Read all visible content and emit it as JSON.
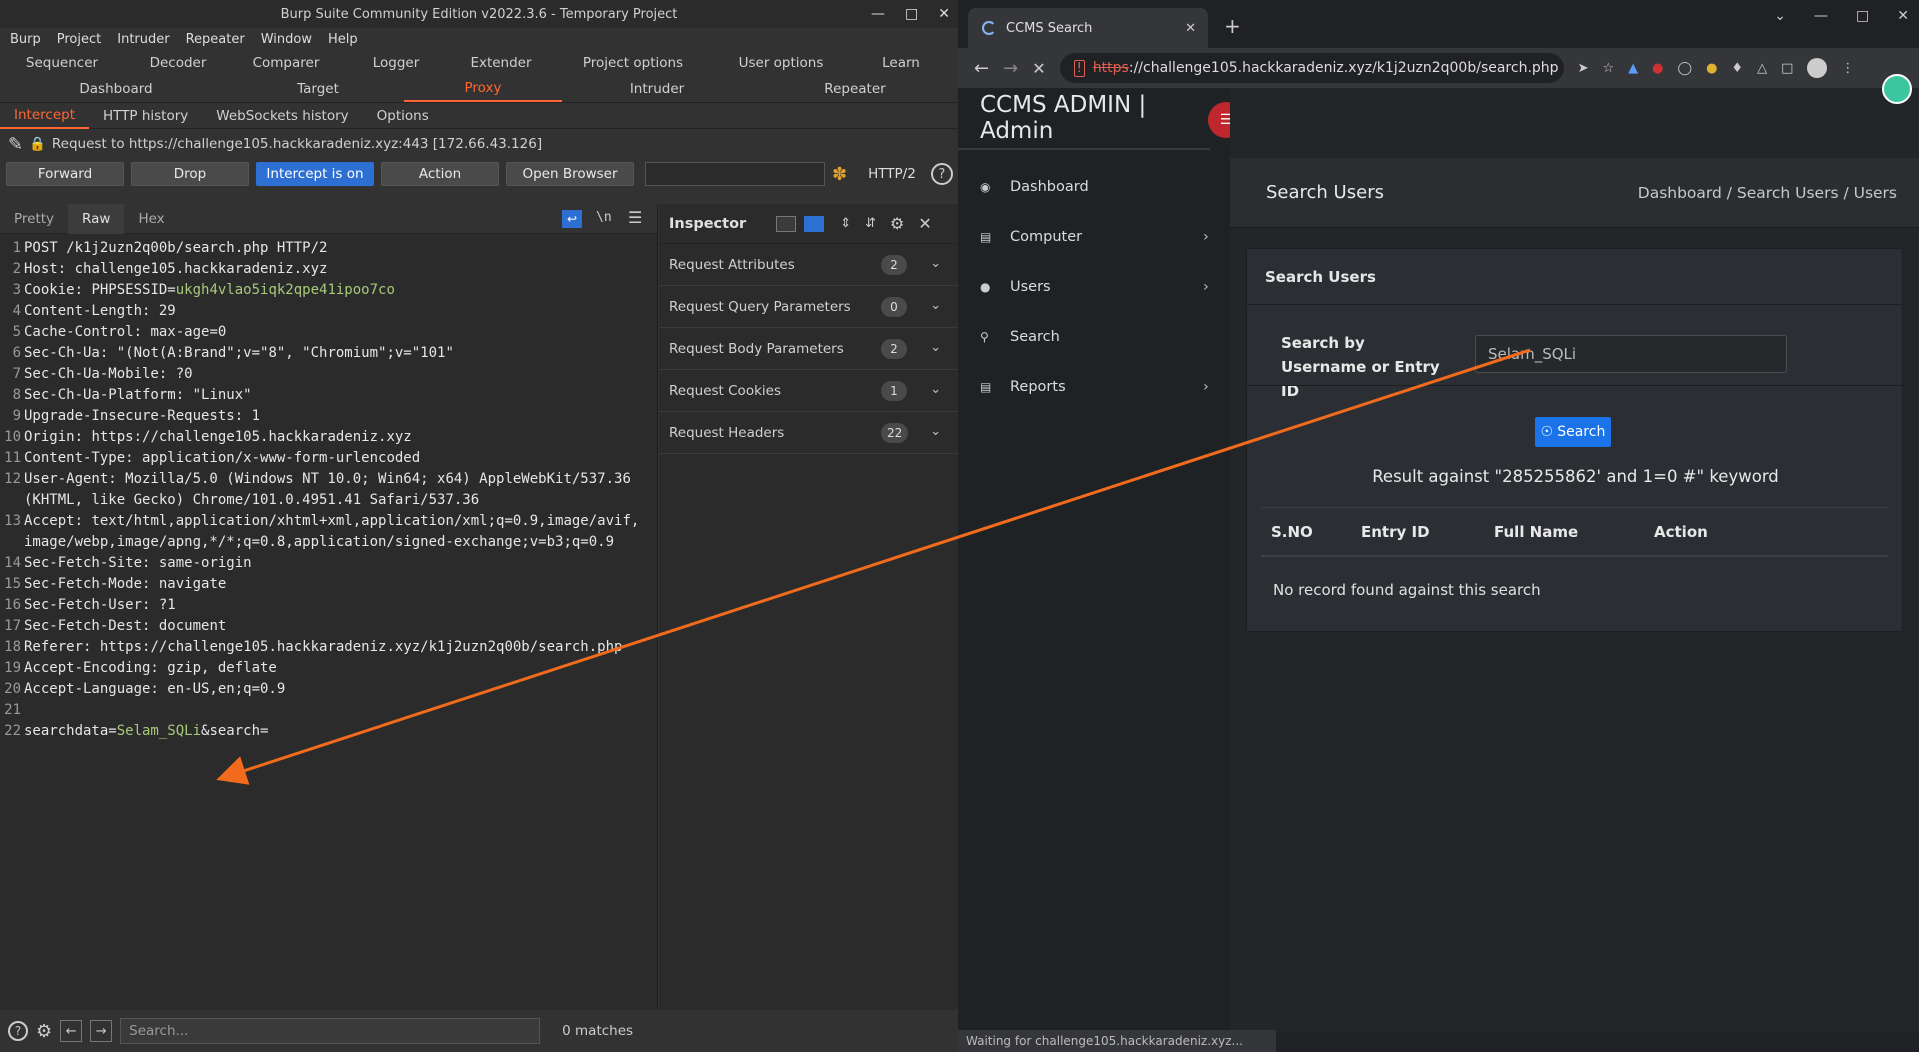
{
  "burp": {
    "title": "Burp Suite Community Edition v2022.3.6 - Temporary Project",
    "menu": [
      "Burp",
      "Project",
      "Intruder",
      "Repeater",
      "Window",
      "Help"
    ],
    "tabs_row1": [
      "Sequencer",
      "Decoder",
      "Comparer",
      "Logger",
      "Extender",
      "Project options",
      "User options",
      "Learn"
    ],
    "tabs_row2": [
      "Dashboard",
      "Target",
      "Proxy",
      "Intruder",
      "Repeater"
    ],
    "subtabs": [
      "Intercept",
      "HTTP history",
      "WebSockets history",
      "Options"
    ],
    "request_to": "Request to https://challenge105.hackkaradeniz.xyz:443  [172.66.43.126]",
    "buttons": {
      "forward": "Forward",
      "drop": "Drop",
      "intercept": "Intercept is on",
      "action": "Action",
      "open_browser": "Open Browser",
      "http2": "HTTP/2"
    },
    "editor_tabs": [
      "Pretty",
      "Raw",
      "Hex"
    ],
    "newline_label": "\\n",
    "lines": [
      {
        "n": "1",
        "k": "POST /k1j2uzn2q00b/search.php HTTP/2",
        "v": ""
      },
      {
        "n": "2",
        "k": "Host:",
        "v": " challenge105.hackkaradeniz.xyz"
      },
      {
        "n": "3",
        "k": "Cookie:",
        "v": " PHPSESSID=",
        "g": "ukgh4vlao5iqk2qpe41ipoo7co"
      },
      {
        "n": "4",
        "k": "Content-Length:",
        "v": " 29"
      },
      {
        "n": "5",
        "k": "Cache-Control:",
        "v": " max-age=0"
      },
      {
        "n": "6",
        "k": "Sec-Ch-Ua:",
        "v": " \"(Not(A:Brand\";v=\"8\", \"Chromium\";v=\"101\""
      },
      {
        "n": "7",
        "k": "Sec-Ch-Ua-Mobile:",
        "v": " ?0"
      },
      {
        "n": "8",
        "k": "Sec-Ch-Ua-Platform:",
        "v": " \"Linux\""
      },
      {
        "n": "9",
        "k": "Upgrade-Insecure-Requests:",
        "v": " 1"
      },
      {
        "n": "10",
        "k": "Origin:",
        "v": " https://challenge105.hackkaradeniz.xyz"
      },
      {
        "n": "11",
        "k": "Content-Type:",
        "v": " application/x-www-form-urlencoded"
      },
      {
        "n": "12",
        "k": "User-Agent:",
        "v": " Mozilla/5.0 (Windows NT 10.0; Win64; x64) AppleWebKit/537.36 (KHTML, like Gecko) Chrome/101.0.4951.41 Safari/537.36"
      },
      {
        "n": "13",
        "k": "Accept:",
        "v": " text/html,application/xhtml+xml,application/xml;q=0.9,image/avif,image/webp,image/apng,*/*;q=0.8,application/signed-exchange;v=b3;q=0.9"
      },
      {
        "n": "14",
        "k": "Sec-Fetch-Site:",
        "v": " same-origin"
      },
      {
        "n": "15",
        "k": "Sec-Fetch-Mode:",
        "v": " navigate"
      },
      {
        "n": "16",
        "k": "Sec-Fetch-User:",
        "v": " ?1"
      },
      {
        "n": "17",
        "k": "Sec-Fetch-Dest:",
        "v": " document"
      },
      {
        "n": "18",
        "k": "Referer:",
        "v": " https://challenge105.hackkaradeniz.xyz/k1j2uzn2q00b/search.php"
      },
      {
        "n": "19",
        "k": "Accept-Encoding:",
        "v": " gzip, deflate"
      },
      {
        "n": "20",
        "k": "Accept-Language:",
        "v": " en-US,en;q=0.9"
      },
      {
        "n": "21",
        "k": "",
        "v": ""
      },
      {
        "n": "22",
        "k": "searchdata=",
        "g": "Selam_SQLi",
        "v2": "&search="
      }
    ],
    "inspector": {
      "title": "Inspector",
      "rows": [
        {
          "label": "Request Attributes",
          "count": "2"
        },
        {
          "label": "Request Query Parameters",
          "count": "0"
        },
        {
          "label": "Request Body Parameters",
          "count": "2"
        },
        {
          "label": "Request Cookies",
          "count": "1"
        },
        {
          "label": "Request Headers",
          "count": "22"
        }
      ]
    },
    "search_placeholder": "Search...",
    "matches": "0 matches"
  },
  "browser": {
    "tab_title": "CCMS Search",
    "url_scheme": "https",
    "url_rest": "://challenge105.hackkaradeniz.xyz/k1j2uzn2q00b/search.php",
    "status": "Waiting for challenge105.hackkaradeniz.xyz...",
    "page": {
      "brand": "CCMS ADMIN | Admin",
      "nav": [
        {
          "label": "Dashboard",
          "icon": "dashboard-icon",
          "arrow": false
        },
        {
          "label": "Computer",
          "icon": "computer-icon",
          "arrow": true
        },
        {
          "label": "Users",
          "icon": "user-icon",
          "arrow": true
        },
        {
          "label": "Search",
          "icon": "search-icon",
          "arrow": false
        },
        {
          "label": "Reports",
          "icon": "report-icon",
          "arrow": true
        }
      ],
      "header_title": "Search Users",
      "breadcrumb": "Dashboard /  Search Users /  Users",
      "card_title": "Search Users",
      "field_label": "Search by Username or Entry ID",
      "field_value": "Selam_SQLi",
      "search_button": "Search",
      "result_text": "Result against \"285255862' and 1=0 #\" keyword",
      "columns": [
        "S.NO",
        "Entry ID",
        "Full Name",
        "Action"
      ],
      "no_record": "No record found against this search"
    }
  },
  "colors": {
    "accent_orange": "#ff6633",
    "burp_blue": "#2d6fd2",
    "arrow": "#f26b1d"
  }
}
